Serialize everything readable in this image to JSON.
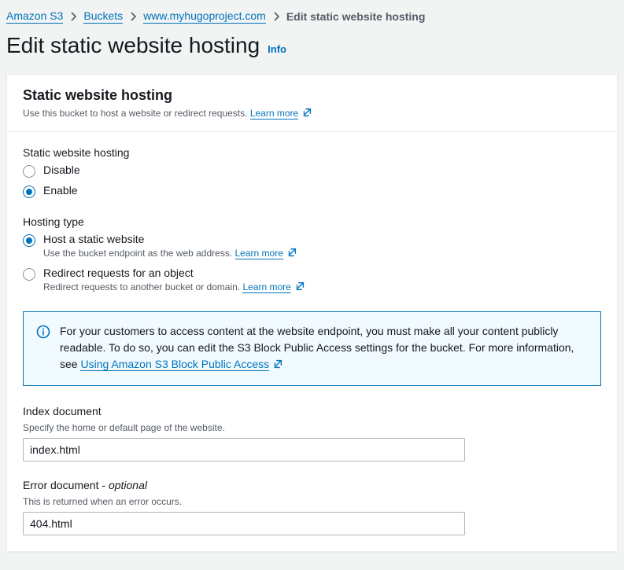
{
  "breadcrumb": {
    "s3": "Amazon S3",
    "buckets": "Buckets",
    "bucket": "www.myhugoproject.com",
    "current": "Edit static website hosting"
  },
  "page": {
    "title": "Edit static website hosting",
    "info": "Info"
  },
  "panel": {
    "title": "Static website hosting",
    "subtitle": "Use this bucket to host a website or redirect requests.",
    "learn_more": "Learn more"
  },
  "hosting": {
    "label": "Static website hosting",
    "disable": "Disable",
    "enable": "Enable"
  },
  "hosting_type": {
    "label": "Hosting type",
    "static_label": "Host a static website",
    "static_desc": "Use the bucket endpoint as the web address.",
    "redirect_label": "Redirect requests for an object",
    "redirect_desc": "Redirect requests to another bucket or domain.",
    "learn_more": "Learn more"
  },
  "notice": {
    "text_before": "For your customers to access content at the website endpoint, you must make all your content publicly readable. To do so, you can edit the S3 Block Public Access settings for the bucket. For more information, see ",
    "link": "Using Amazon S3 Block Public Access"
  },
  "index_doc": {
    "label": "Index document",
    "desc": "Specify the home or default page of the website.",
    "value": "index.html"
  },
  "error_doc": {
    "label_main": "Error document - ",
    "label_opt": "optional",
    "desc": "This is returned when an error occurs.",
    "value": "404.html"
  }
}
